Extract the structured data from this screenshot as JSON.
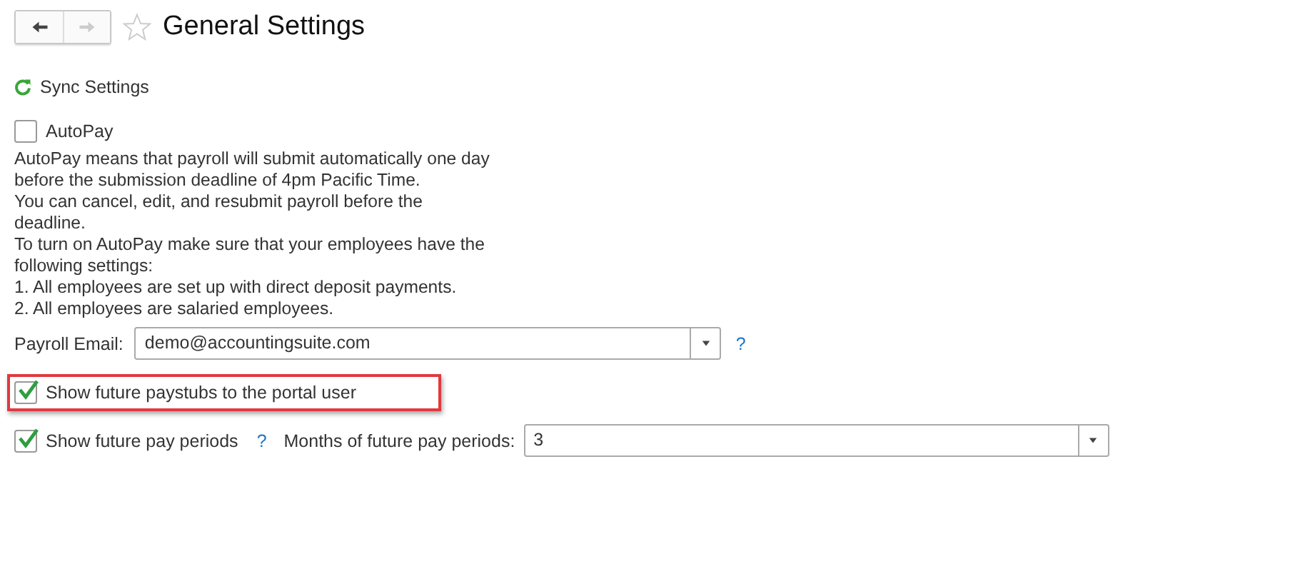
{
  "title": "General Settings",
  "favorite": false,
  "sync_link": "Sync Settings",
  "autopay": {
    "label": "AutoPay",
    "checked": false
  },
  "autopay_description": [
    "AutoPay means that payroll will submit automatically one day",
    "before the submission deadline of 4pm Pacific Time.",
    "You can cancel, edit, and resubmit payroll before the",
    "deadline.",
    "To turn on AutoPay make sure that your employees have the",
    "following settings:",
    "1. All employees are set up with direct deposit payments.",
    "2. All employees are salaried employees."
  ],
  "payroll_email": {
    "label": "Payroll Email:",
    "value": "demo@accountingsuite.com",
    "help": "?"
  },
  "paystubs_option": {
    "label": "Show future paystubs to the portal user",
    "checked": true,
    "highlighted": true
  },
  "pay_periods_option": {
    "label": "Show future pay periods",
    "checked": true,
    "help": "?",
    "months_label": "Months of future pay periods:",
    "months_value": "3"
  }
}
